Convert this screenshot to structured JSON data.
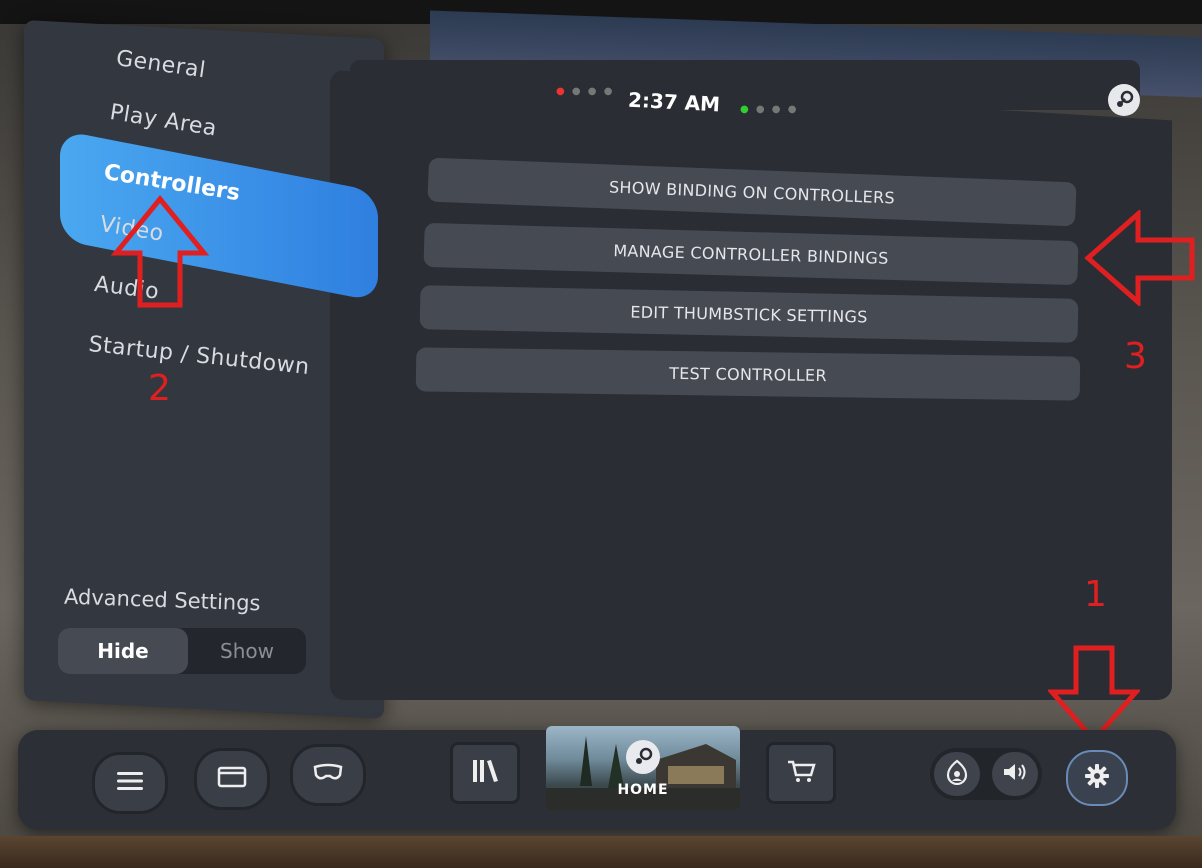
{
  "clock": "2:37 AM",
  "sidebar": {
    "items": [
      {
        "label": "General"
      },
      {
        "label": "Play Area"
      },
      {
        "label": "Controllers",
        "active": true
      },
      {
        "label": "Video"
      },
      {
        "label": "Audio"
      },
      {
        "label": "Startup / Shutdown"
      }
    ],
    "advanced": {
      "label": "Advanced Settings",
      "hide": "Hide",
      "show": "Show",
      "selected": "Hide"
    }
  },
  "main": {
    "buttons": [
      {
        "label": "SHOW BINDING ON CONTROLLERS"
      },
      {
        "label": "MANAGE CONTROLLER BINDINGS"
      },
      {
        "label": "EDIT THUMBSTICK SETTINGS"
      },
      {
        "label": "TEST CONTROLLER"
      }
    ]
  },
  "dock": {
    "home_label": "HOME",
    "icons": [
      "menu-icon",
      "window-icon",
      "headset-icon",
      "library-icon",
      "store-icon",
      "avatar-icon",
      "volume-icon",
      "settings-gear-icon"
    ]
  },
  "annotations": {
    "one": "1",
    "two": "2",
    "three": "3"
  },
  "colors": {
    "accent": "#3a8ee8",
    "annotation": "#e02020"
  }
}
